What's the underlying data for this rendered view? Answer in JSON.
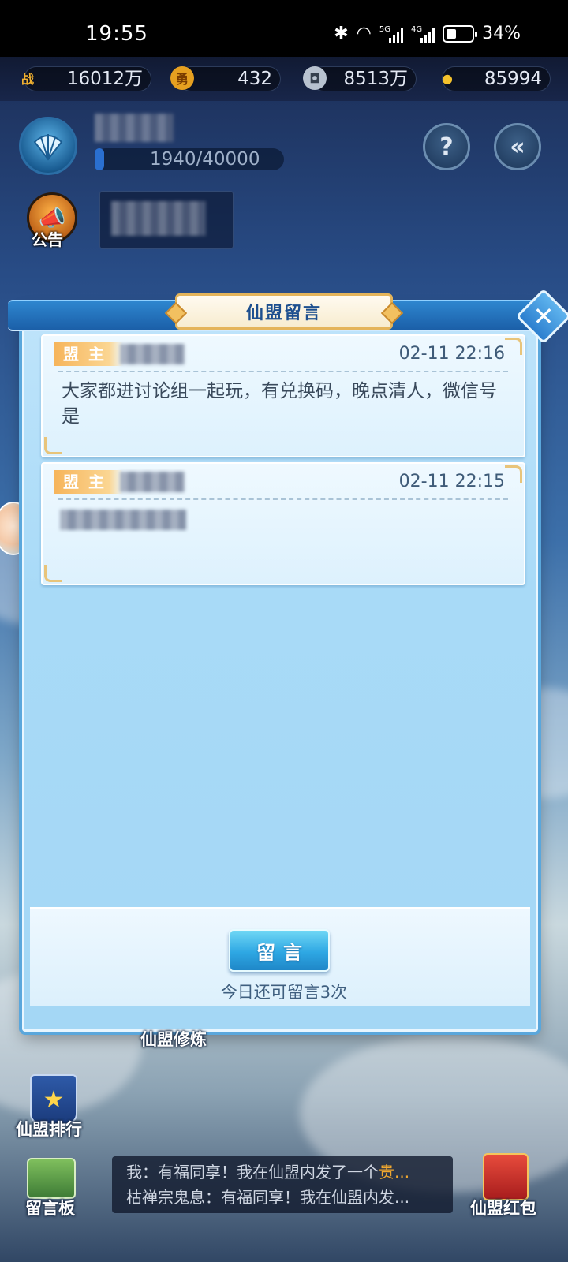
{
  "status_bar": {
    "time": "19:55",
    "network_1": "5G",
    "network_2": "4G",
    "battery": "34%"
  },
  "resources": [
    {
      "icon": "battle-power-icon",
      "glyph": "战",
      "value": "16012万"
    },
    {
      "icon": "medal-icon",
      "glyph": "勇",
      "value": "432"
    },
    {
      "icon": "silver-coin-icon",
      "glyph": "◘",
      "value": "8513万"
    },
    {
      "icon": "gold-ingot-icon",
      "glyph": "●",
      "value": "85994"
    }
  ],
  "guild": {
    "exp": "1940/40000",
    "exp_progress": 0.0485,
    "announcement_label": "公告"
  },
  "modal": {
    "title": "仙盟留言",
    "close_glyph": "✕",
    "messages": [
      {
        "role": "盟主",
        "time": "02-11 22:16",
        "text": "大家都进讨论组一起玩，有兑换码，晚点清人，微信号是"
      },
      {
        "role": "盟主",
        "time": "02-11 22:15",
        "text": ""
      }
    ],
    "post_button": "留言",
    "remaining": "今日还可留言3次"
  },
  "bottom": {
    "cultivation_label": "仙盟修炼",
    "ranking_label": "仙盟排行",
    "board_label": "留言板",
    "red_packet_label": "仙盟红包",
    "chat": [
      {
        "prefix": "我：有福同享！我在仙盟内发了一个",
        "highlight": "贵..."
      },
      {
        "prefix": "枯禅宗鬼息：有福同享！我在仙盟内发...",
        "highlight": ""
      }
    ]
  },
  "colors": {
    "accent": "#2ea7e3",
    "badge": "#f6b45a",
    "panel": "#a8daf7"
  }
}
